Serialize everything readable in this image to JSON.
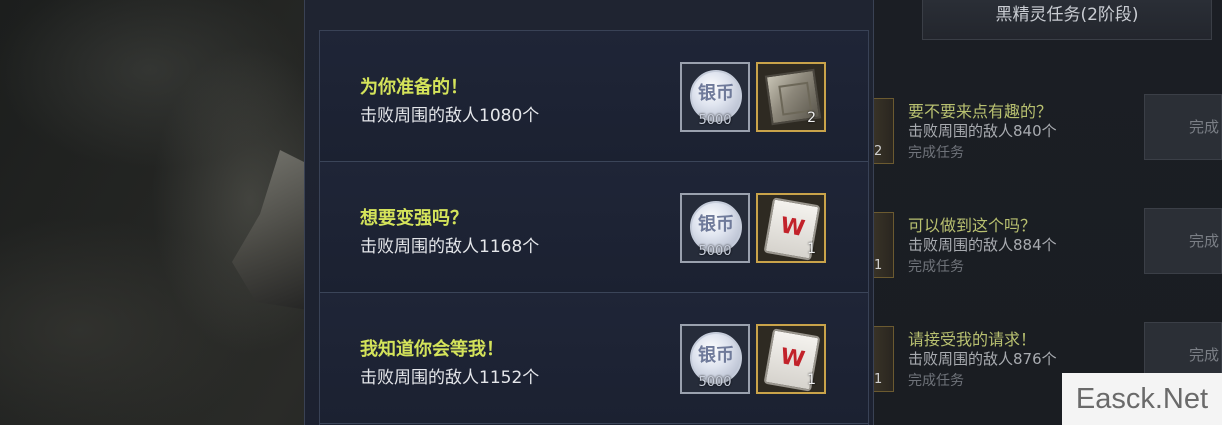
{
  "header": {
    "title": "",
    "close_symbol": "✕"
  },
  "tasks": [
    {
      "title": "为你准备的！",
      "desc": "击败周围的敌人1080个",
      "rewards": [
        {
          "kind": "silver-coin",
          "label": "银币",
          "amount": "5000"
        },
        {
          "kind": "box",
          "qty": "2"
        }
      ]
    },
    {
      "title": "想要变强吗？",
      "desc": "击败周围的敌人1168个",
      "rewards": [
        {
          "kind": "silver-coin",
          "label": "银币",
          "amount": "5000"
        },
        {
          "kind": "scroll",
          "qty": "1"
        }
      ]
    },
    {
      "title": "我知道你会等我！",
      "desc": "击败周围的敌人1152个",
      "rewards": [
        {
          "kind": "silver-coin",
          "label": "银币",
          "amount": "5000"
        },
        {
          "kind": "scroll",
          "qty": "1"
        }
      ]
    }
  ],
  "side_panel": {
    "tab_label": "黑精灵任务(2阶段)",
    "items": [
      {
        "title": "要不要来点有趣的？",
        "desc": "击败周围的敌人840个",
        "status": "完成任务",
        "reward_qty": "2",
        "button": "完成"
      },
      {
        "title": "可以做到这个吗？",
        "desc": "击败周围的敌人884个",
        "status": "完成任务",
        "reward_qty": "1",
        "button": "完成"
      },
      {
        "title": "请接受我的请求！",
        "desc": "击败周围的敌人876个",
        "status": "完成任务",
        "reward_qty": "1",
        "button": "完成"
      }
    ]
  },
  "watermark": "Easck.Net"
}
